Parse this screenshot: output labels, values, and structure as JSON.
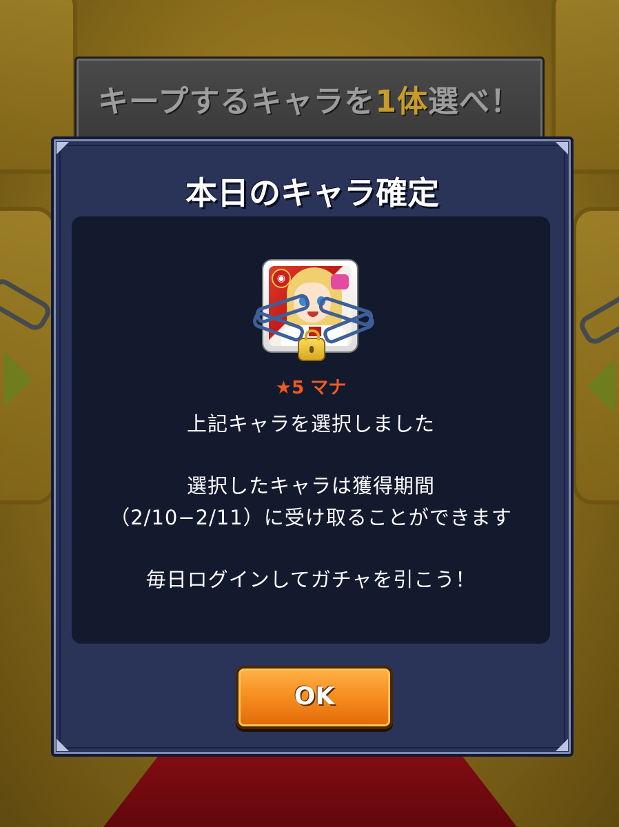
{
  "banner": {
    "text_before": "キープするキャラを",
    "text_highlight": "1体",
    "text_after": "選べ！"
  },
  "dialog": {
    "title": "本日のキャラ確定",
    "character": {
      "rarity_name": "★5 マナ",
      "element_icon": "fire-element-badge",
      "locked": true
    },
    "messages": {
      "line1": "上記キャラを選択しました",
      "line2": "選択したキャラは獲得期間",
      "line3": "（2/10−2/11）に受け取ることができます",
      "line4": "毎日ログインしてガチャを引こう！"
    },
    "ok_label": "OK"
  },
  "colors": {
    "dialog_bg": "#2a3358",
    "content_bg": "#141a2e",
    "accent_orange": "#ee5a24",
    "ok_button": "#f78c1e",
    "banner_highlight": "#c89c2a"
  }
}
